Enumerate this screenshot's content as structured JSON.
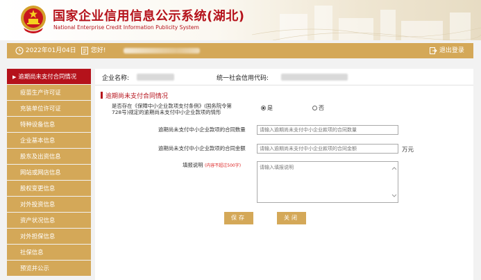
{
  "header": {
    "title_cn": "国家企业信用信息公示系统(湖北)",
    "title_en": "National Enterprise Credit Information Publicity System"
  },
  "topbar": {
    "date": "2022年01月04日",
    "greeting": "您好!",
    "logout": "退出登录"
  },
  "sidebar": {
    "items": [
      "逾期尚未支付合同情况",
      "疫苗生产许可证",
      "充装单位许可证",
      "特种设备信息",
      "企业基本信息",
      "股东及出资信息",
      "网站或网店信息",
      "股权变更信息",
      "对外投资信息",
      "资产状况信息",
      "对外担保信息",
      "社保信息",
      "预览并公示"
    ],
    "active_index": 0
  },
  "company": {
    "name_label": "企业名称:",
    "credit_code_label": "统一社会信用代码:"
  },
  "form": {
    "section_title": "逾期尚未支付合同情况",
    "question_line1": "是否存在《保障中小企业款项支付条例》(国务院令第",
    "question_line2": "728号)规定的逾期尚未支付中小企业款项的情形",
    "option_yes": "是",
    "option_no": "否",
    "selected": "是",
    "count_label": "逾期尚未支付中小企业款项的合同数量",
    "count_placeholder": "请输入逾期尚未支付中小企业款项的合同数量",
    "amount_label": "逾期尚未支付中小企业款项的合同金额",
    "amount_placeholder": "请输入逾期尚未支付中小企业款项的合同金额",
    "amount_unit": "万元",
    "note_label": "填报说明",
    "note_limit": "(内容不超过500字)",
    "note_placeholder": "请输入填报说明"
  },
  "buttons": {
    "save": "保存",
    "close": "关闭"
  },
  "colors": {
    "brand_red": "#b5121b",
    "gold": "#d4a858"
  }
}
